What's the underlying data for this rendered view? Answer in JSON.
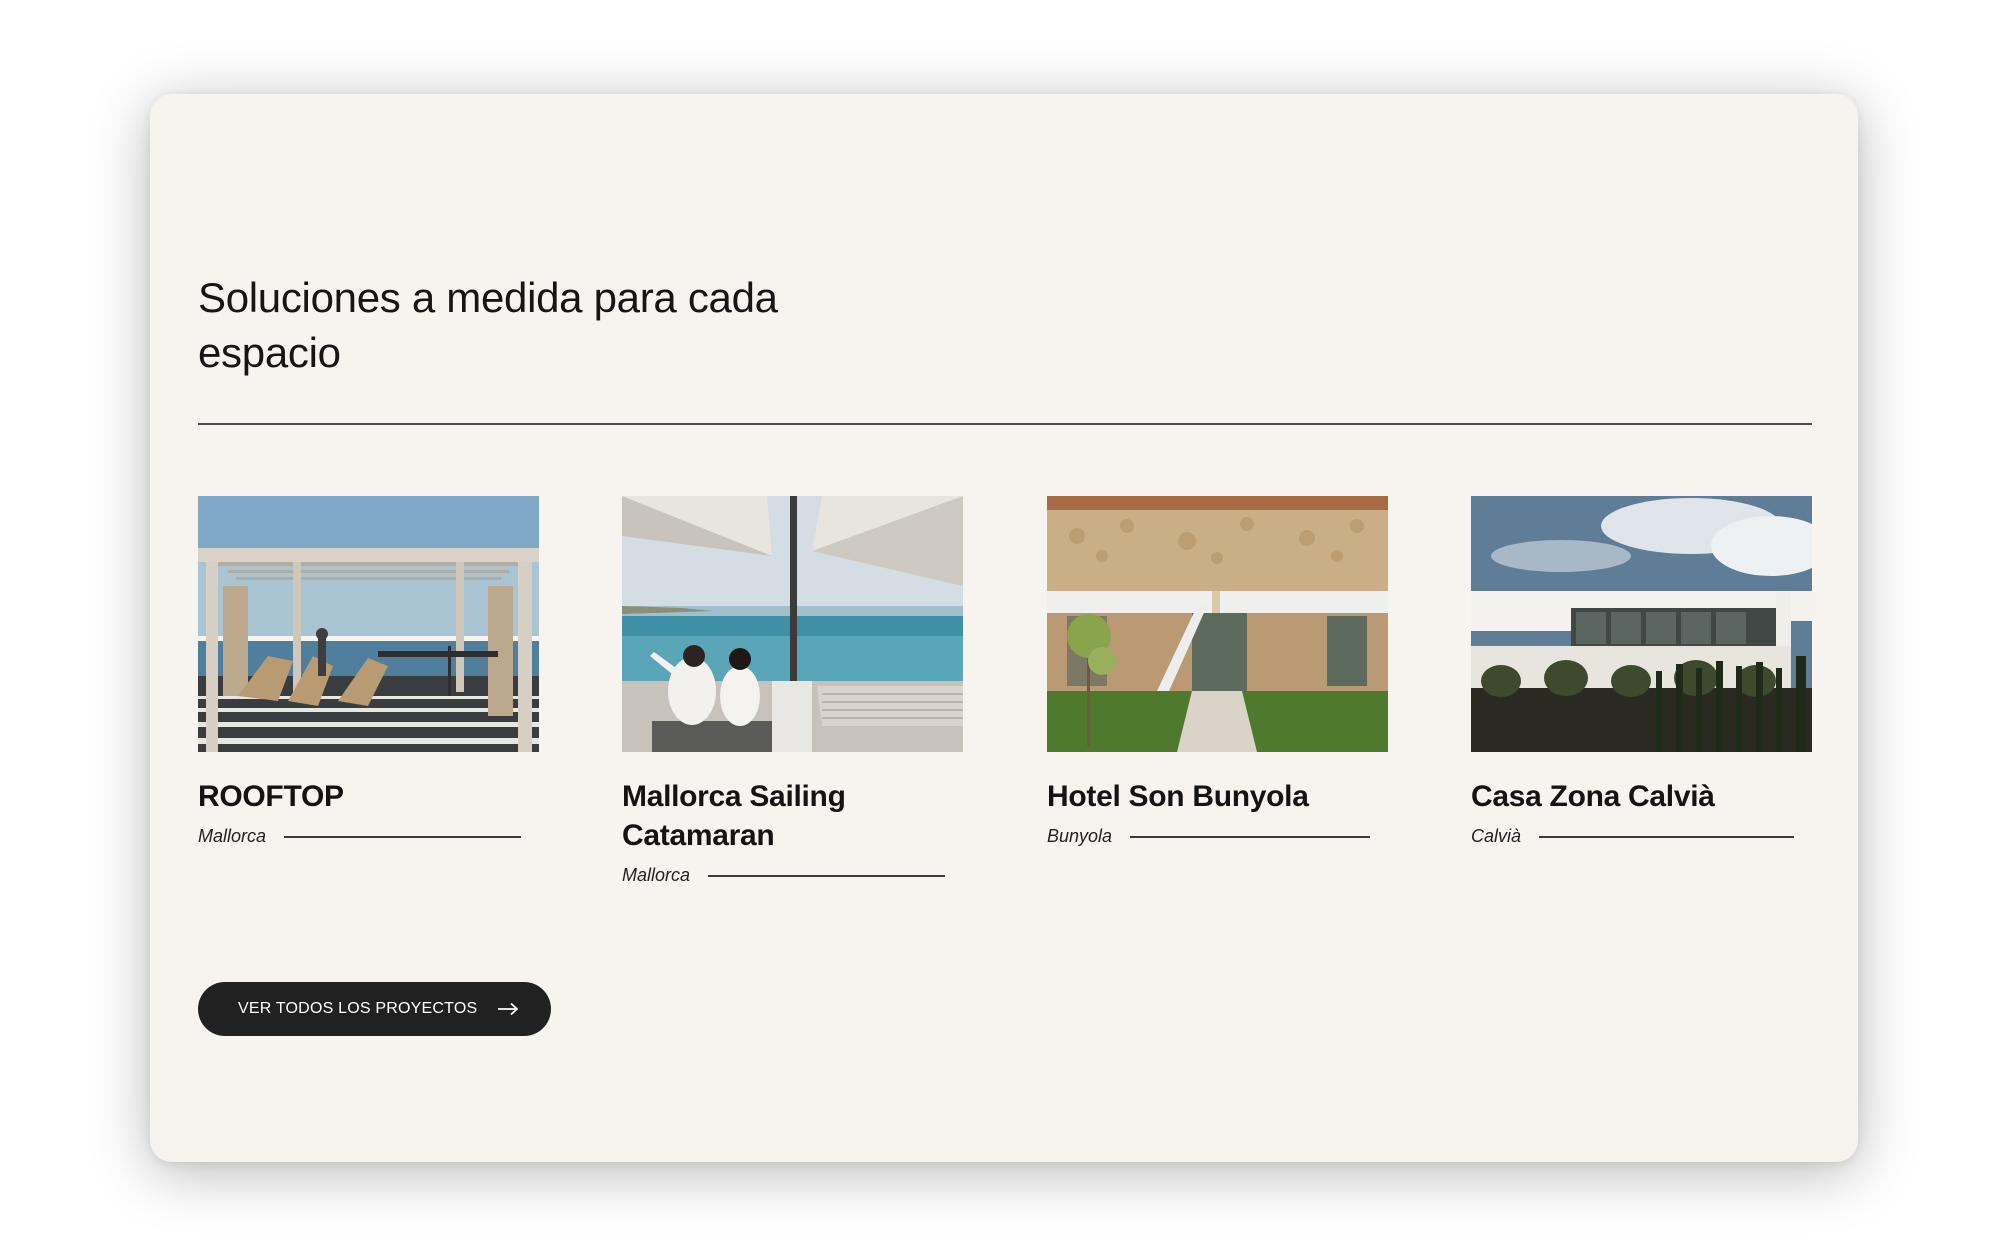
{
  "section": {
    "heading": "Soluciones a medida para cada espacio"
  },
  "projects": [
    {
      "title": "ROOFTOP",
      "location": "Mallorca",
      "image": "pergola-terrace-photo"
    },
    {
      "title": "Mallorca Sailing Catamaran",
      "location": "Mallorca",
      "image": "catamaran-couple-photo"
    },
    {
      "title": "Hotel Son Bunyola",
      "location": "Bunyola",
      "image": "stone-building-garden-photo"
    },
    {
      "title": "Casa Zona Calvià",
      "location": "Calvià",
      "image": "modern-villa-photo"
    }
  ],
  "cta": {
    "label": "VER TODOS LOS PROYECTOS",
    "icon": "arrow-right-icon"
  },
  "colors": {
    "card_background": "#f7f3ef",
    "button_background": "#212121",
    "text": "#151515"
  }
}
